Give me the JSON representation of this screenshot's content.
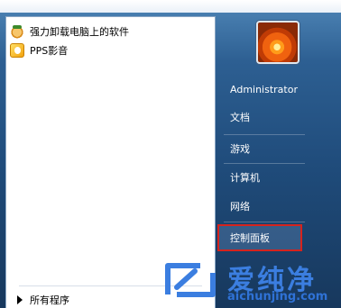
{
  "programs": [
    {
      "label": "强力卸载电脑上的软件",
      "icon": "uninstall-icon"
    },
    {
      "label": "PPS影音",
      "icon": "pps-player-icon"
    }
  ],
  "all_programs": {
    "label": "所有程序",
    "icon": "triangle-right-icon"
  },
  "user": {
    "avatar_icon": "flower-avatar-icon"
  },
  "right_links": [
    {
      "label": "Administrator"
    },
    {
      "label": "文档"
    },
    {
      "label": "游戏"
    },
    {
      "label": "计算机"
    },
    {
      "label": "网络"
    },
    {
      "label": "控制面板"
    }
  ],
  "watermark": {
    "title": "爱纯净",
    "url": "aichunjing.com"
  },
  "colors": {
    "highlight_border": "#d6231d",
    "watermark_blue": "#3b7ee0",
    "menu_blue": "#1f4b7a"
  }
}
